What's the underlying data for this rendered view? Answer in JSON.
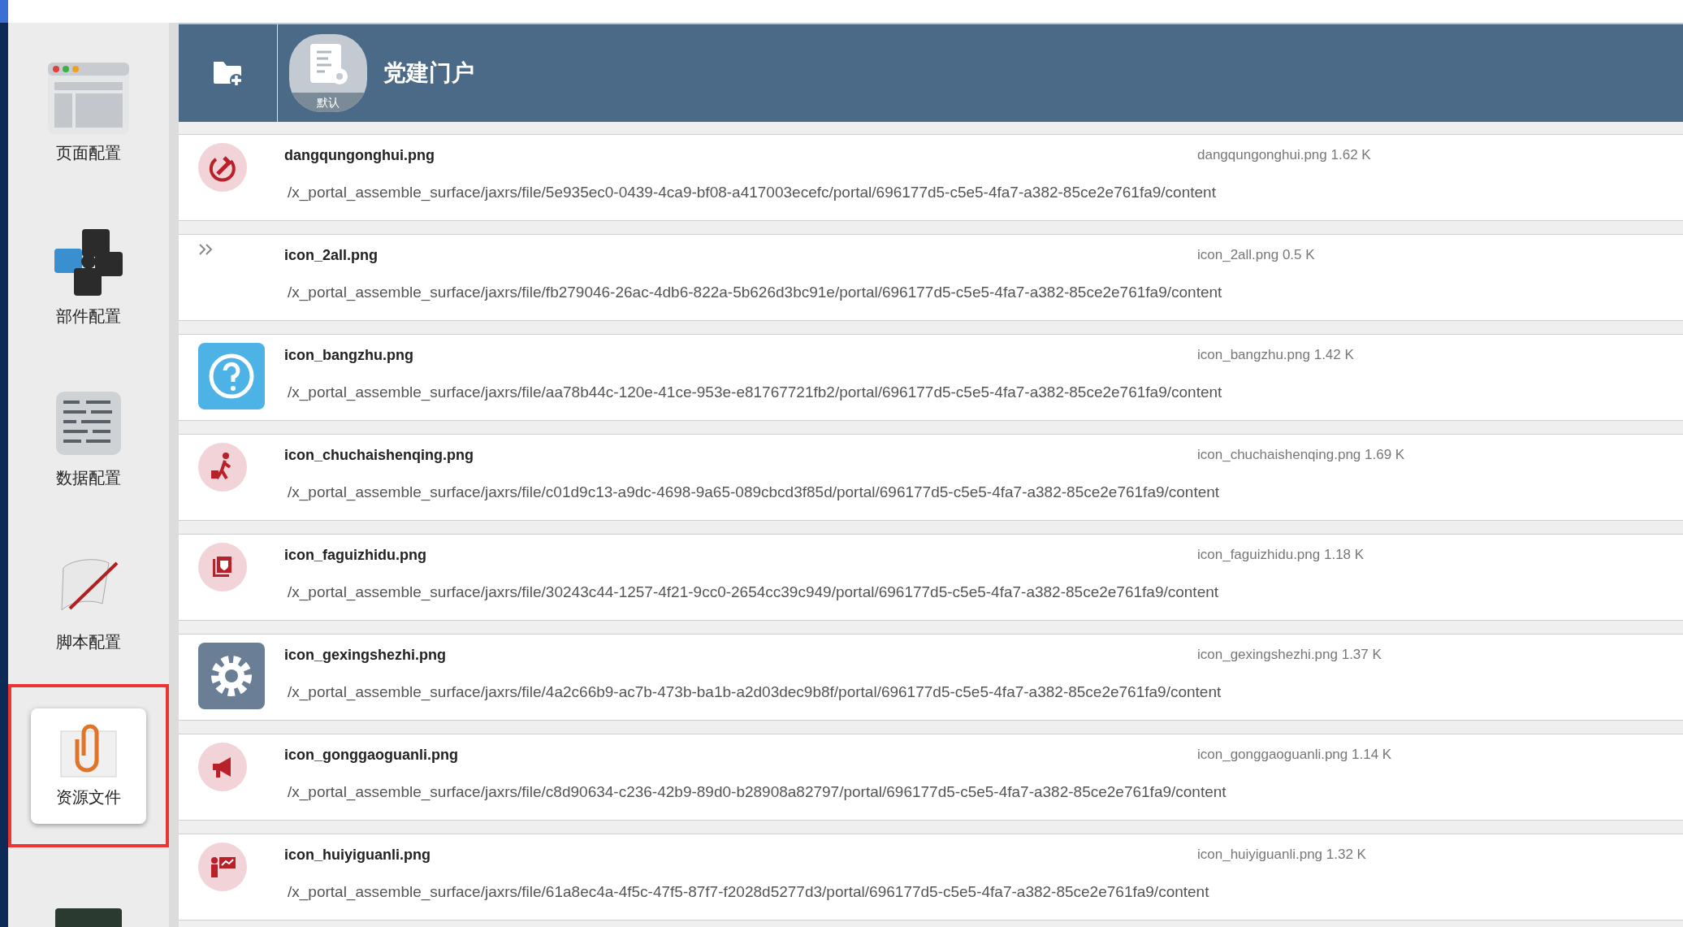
{
  "sidebar": {
    "items": [
      {
        "label": "页面配置",
        "selected": false
      },
      {
        "label": "部件配置",
        "selected": false
      },
      {
        "label": "数据配置",
        "selected": false
      },
      {
        "label": "脚本配置",
        "selected": false
      },
      {
        "label": "资源文件",
        "selected": true
      },
      {
        "selected": false
      }
    ]
  },
  "header": {
    "portal_badge": "默认",
    "title": "党建门户"
  },
  "files": [
    {
      "name": "dangqungonghui.png",
      "path": "/x_portal_assemble_surface/jaxrs/file/5e935ec0-0439-4ca9-bf08-a417003ecefc/portal/696177d5-c5e5-4fa7-a382-85ce2e761fa9/content",
      "info": "dangqungonghui.png 1.62 K"
    },
    {
      "name": "icon_2all.png",
      "path": "/x_portal_assemble_surface/jaxrs/file/fb279046-26ac-4db6-822a-5b626d3bc91e/portal/696177d5-c5e5-4fa7-a382-85ce2e761fa9/content",
      "info": "icon_2all.png 0.5 K"
    },
    {
      "name": "icon_bangzhu.png",
      "path": "/x_portal_assemble_surface/jaxrs/file/aa78b44c-120e-41ce-953e-e81767721fb2/portal/696177d5-c5e5-4fa7-a382-85ce2e761fa9/content",
      "info": "icon_bangzhu.png 1.42 K"
    },
    {
      "name": "icon_chuchaishenqing.png",
      "path": "/x_portal_assemble_surface/jaxrs/file/c01d9c13-a9dc-4698-9a65-089cbcd3f85d/portal/696177d5-c5e5-4fa7-a382-85ce2e761fa9/content",
      "info": "icon_chuchaishenqing.png 1.69 K"
    },
    {
      "name": "icon_faguizhidu.png",
      "path": "/x_portal_assemble_surface/jaxrs/file/30243c44-1257-4f21-9cc0-2654cc39c949/portal/696177d5-c5e5-4fa7-a382-85ce2e761fa9/content",
      "info": "icon_faguizhidu.png 1.18 K"
    },
    {
      "name": "icon_gexingshezhi.png",
      "path": "/x_portal_assemble_surface/jaxrs/file/4a2c66b9-ac7b-473b-ba1b-a2d03dec9b8f/portal/696177d5-c5e5-4fa7-a382-85ce2e761fa9/content",
      "info": "icon_gexingshezhi.png 1.37 K"
    },
    {
      "name": "icon_gonggaoguanli.png",
      "path": "/x_portal_assemble_surface/jaxrs/file/c8d90634-c236-42b9-89d0-b28908a82797/portal/696177d5-c5e5-4fa7-a382-85ce2e761fa9/content",
      "info": "icon_gonggaoguanli.png 1.14 K"
    },
    {
      "name": "icon_huiyiguanli.png",
      "path": "/x_portal_assemble_surface/jaxrs/file/61a8ec4a-4f5c-47f5-87f7-f2028d5277d3/portal/696177d5-c5e5-4fa7-a382-85ce2e761fa9/content",
      "info": "icon_huiyiguanli.png 1.32 K"
    }
  ]
}
